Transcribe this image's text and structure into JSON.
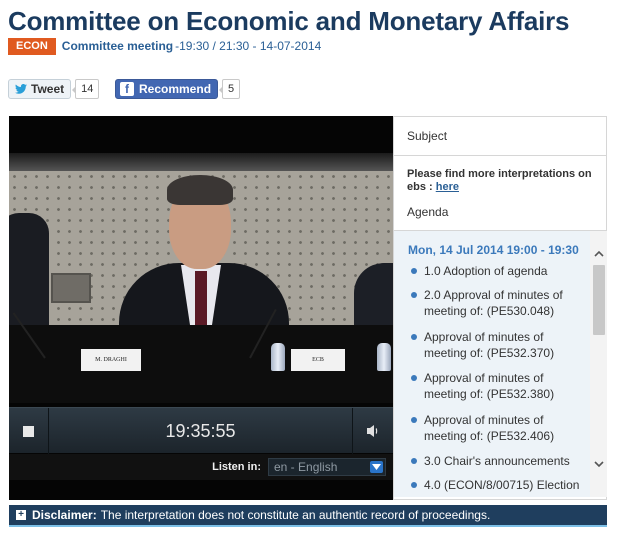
{
  "header": {
    "title": "Committee on Economic and Monetary Affairs",
    "badge": "ECON",
    "meeting_label": "Committee meeting",
    "meeting_time": "-19:30 / 21:30 - 14-07-2014"
  },
  "share": {
    "tweet_label": "Tweet",
    "tweet_count": "14",
    "recommend_label": "Recommend",
    "recommend_count": "5"
  },
  "player": {
    "nameplate_left": "M. DRAGHI",
    "nameplate_right": "ECB",
    "timecode": "19:35:55",
    "listen_label": "Listen in:",
    "language": "en - English"
  },
  "sidepanel": {
    "subject": "Subject",
    "info_text": "Please find more interpretations on ebs : ",
    "info_link": "here",
    "agenda": "Agenda",
    "date_header": "Mon, 14 Jul 2014 19:00 - 19:30",
    "items": [
      "1.0 Adoption of agenda",
      "2.0 Approval of minutes of meeting of: (PE530.048)",
      "Approval of minutes of meeting of: (PE532.370)",
      "Approval of minutes of meeting of: (PE532.380)",
      "Approval of minutes of meeting of: (PE532.406)",
      "3.0 Chair's announcements",
      "4.0 (ECON/8/00715) Election"
    ]
  },
  "disclaimer": {
    "label": "Disclaimer:",
    "text": "The interpretation does not constitute an authentic record of proceedings."
  },
  "colors": {
    "title": "#1b3b5f",
    "badge": "#e05a20",
    "link": "#2a5f95",
    "accent": "#3b79bb",
    "disclaimer_bg": "#1f3e5e"
  }
}
